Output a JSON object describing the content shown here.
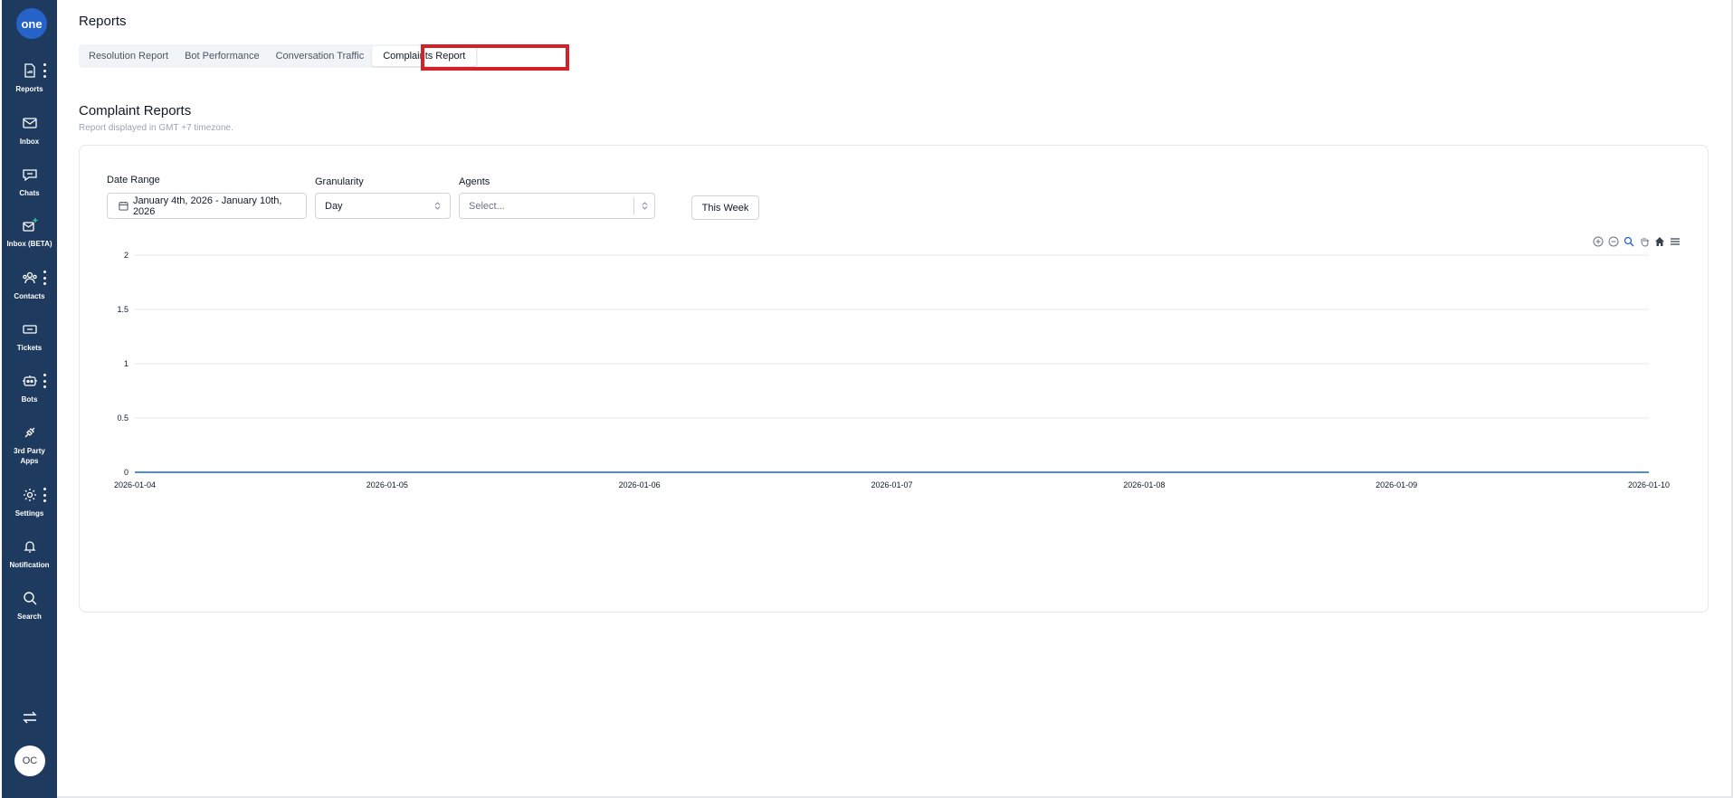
{
  "sidebar": {
    "logo": "one",
    "items": [
      {
        "label": "Reports",
        "icon": "report-icon"
      },
      {
        "label": "Inbox",
        "icon": "mail-icon"
      },
      {
        "label": "Chats",
        "icon": "chat-icon"
      },
      {
        "label": "Inbox (BETA)",
        "icon": "mail-sparkle-icon"
      },
      {
        "label": "Contacts",
        "icon": "contacts-icon"
      },
      {
        "label": "Tickets",
        "icon": "ticket-icon"
      },
      {
        "label": "Bots",
        "icon": "bot-icon"
      },
      {
        "label": "3rd Party\nApps",
        "icon": "plug-icon"
      },
      {
        "label": "Settings",
        "icon": "gear-icon"
      },
      {
        "label": "Notification",
        "icon": "bell-icon"
      },
      {
        "label": "Search",
        "icon": "search-icon"
      }
    ],
    "avatar": "OC"
  },
  "header": {
    "title": "Reports"
  },
  "tabs": [
    {
      "label": "Resolution Report"
    },
    {
      "label": "Bot Performance"
    },
    {
      "label": "Conversation Traffic"
    },
    {
      "label": "Complaints Report",
      "active": true
    }
  ],
  "section": {
    "title": "Complaint Reports",
    "subtitle": "Report displayed in GMT +7 timezone."
  },
  "filters": {
    "date_range_label": "Date Range",
    "date_range_value": "January 4th, 2026 - January 10th, 2026",
    "granularity_label": "Granularity",
    "granularity_value": "Day",
    "agents_label": "Agents",
    "agents_placeholder": "Select...",
    "this_week_label": "This Week"
  },
  "colors": {
    "sidebar": "#1e3a5f",
    "accent": "#2563c9",
    "line": "#4a90d9",
    "highlight": "#d42029"
  },
  "chart_data": {
    "type": "line",
    "x": [
      "2026-01-04",
      "2026-01-05",
      "2026-01-06",
      "2026-01-07",
      "2026-01-08",
      "2026-01-09",
      "2026-01-10"
    ],
    "series": [
      {
        "values": [
          0,
          0,
          0,
          0,
          0,
          0,
          0
        ]
      }
    ],
    "ylim": [
      0,
      2
    ],
    "yticks": [
      "2",
      "1.5",
      "1",
      "0.5",
      "0"
    ],
    "grid": true
  }
}
